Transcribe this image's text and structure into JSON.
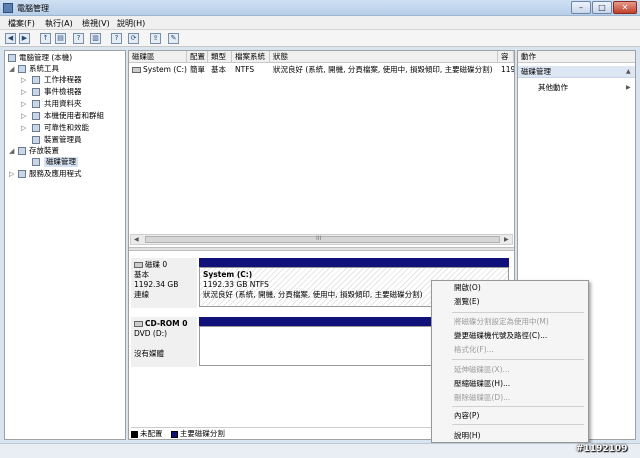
{
  "window": {
    "title": "電腦管理",
    "min_label": "–",
    "max_label": "□",
    "close_label": "✕"
  },
  "menu": [
    "檔案(F)",
    "執行(A)",
    "檢視(V)",
    "說明(H)"
  ],
  "toolbar": {
    "icons": [
      "back-icon",
      "forward-icon",
      "up-icon",
      "show-hide-tree-icon",
      "help-icon",
      "properties-icon",
      "help-topic-icon",
      "refresh-icon",
      "export-icon",
      "settings-icon"
    ],
    "glyphs": [
      "◀",
      "▶",
      "↑",
      "▤",
      "?",
      "▥",
      "?",
      "⟳",
      "⇪",
      "✎"
    ]
  },
  "tree": {
    "root": "電腦管理 (本機)",
    "system_tools": "系統工具",
    "task_scheduler": "工作排程器",
    "event_viewer": "事件檢視器",
    "shared_folders": "共用資料夾",
    "local_users": "本機使用者和群組",
    "reliability": "可靠性和效能",
    "device_manager": "裝置管理員",
    "storage": "存放裝置",
    "disk_management": "磁碟管理",
    "services": "服務及應用程式"
  },
  "volume_list": {
    "headers": [
      "磁碟區",
      "配置",
      "類型",
      "檔案系統",
      "狀態",
      "容"
    ],
    "row": [
      "System (C:)",
      "簡單",
      "基本",
      "NTFS",
      "狀況良好 (系統, 開機, 分頁檔案, 使用中, 損毀傾印, 主要磁碟分割)",
      "119"
    ],
    "scroll_mid": "III"
  },
  "disk0": {
    "name": "磁碟 0",
    "type": "基本",
    "size": "1192.34 GB",
    "status": "連線"
  },
  "partition": {
    "name": "System (C:)",
    "size": "1192.33 GB NTFS",
    "status": "狀況良好 (系統, 開機, 分頁檔案, 使用中, 損毀傾印, 主要磁碟分割)"
  },
  "cdrom": {
    "name": "CD-ROM 0",
    "drive": "DVD (D:)",
    "status": "沒有媒體"
  },
  "legend": {
    "unallocated": "未配置",
    "primary": "主要磁碟分割",
    "unallocated_color": "#000000",
    "primary_color": "#10127a"
  },
  "actions": {
    "header": "動作",
    "section": "磁碟管理",
    "more": "其他動作"
  },
  "context_menu": {
    "open": "開啟(O)",
    "explore": "瀏覽(E)",
    "mark_active": "將磁碟分割設定為使用中(M)",
    "change_letter": "變更磁碟機代號及路徑(C)...",
    "format": "格式化(F)...",
    "extend": "延伸磁碟區(X)...",
    "shrink": "壓縮磁碟區(H)...",
    "delete": "刪除磁碟區(D)...",
    "properties": "內容(P)",
    "help": "說明(H)"
  },
  "watermark": "#1192109"
}
